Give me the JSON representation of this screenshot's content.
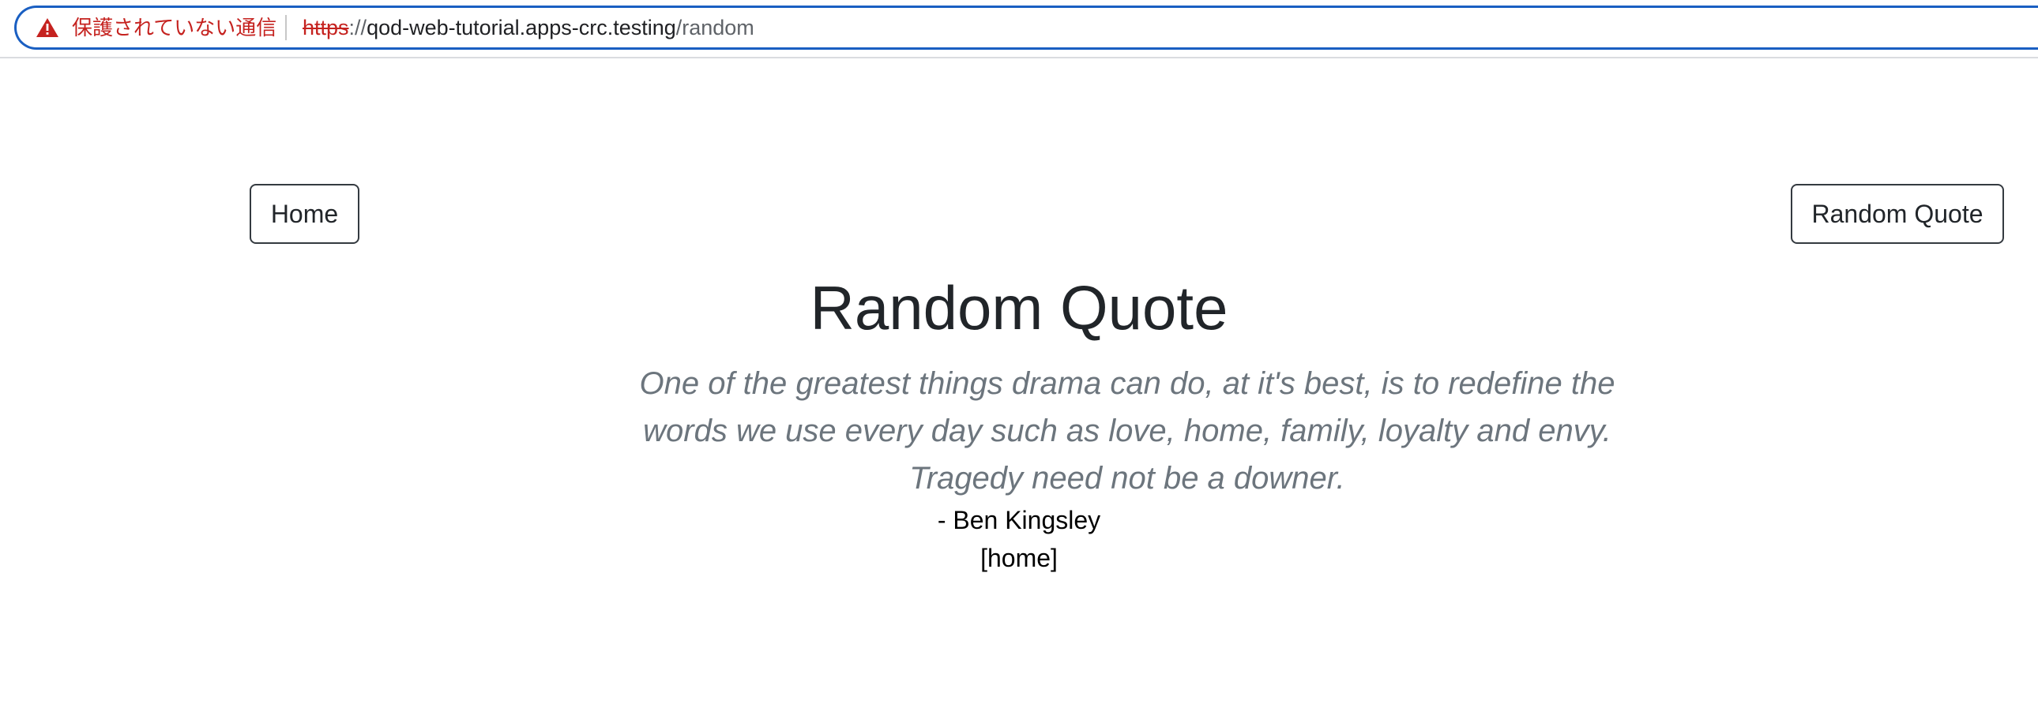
{
  "browser": {
    "security_label": "保護されていない通信",
    "url_scheme": "https",
    "url_separator": "://",
    "url_host": "qod-web-tutorial.apps-crc.testing",
    "url_path": "/random",
    "warning_icon": "warning-triangle-icon",
    "warning_color": "#c5221f",
    "focus_ring_color": "#1a5fc2"
  },
  "nav": {
    "home_label": "Home",
    "random_label": "Random Quote"
  },
  "main": {
    "title": "Random Quote",
    "quote": "One of the greatest things drama can do, at it's best, is to redefine the words we use every day such as love, home, family, loyalty and envy. Tragedy need not be a downer.",
    "author": "- Ben Kingsley",
    "home_link": "[home]"
  }
}
